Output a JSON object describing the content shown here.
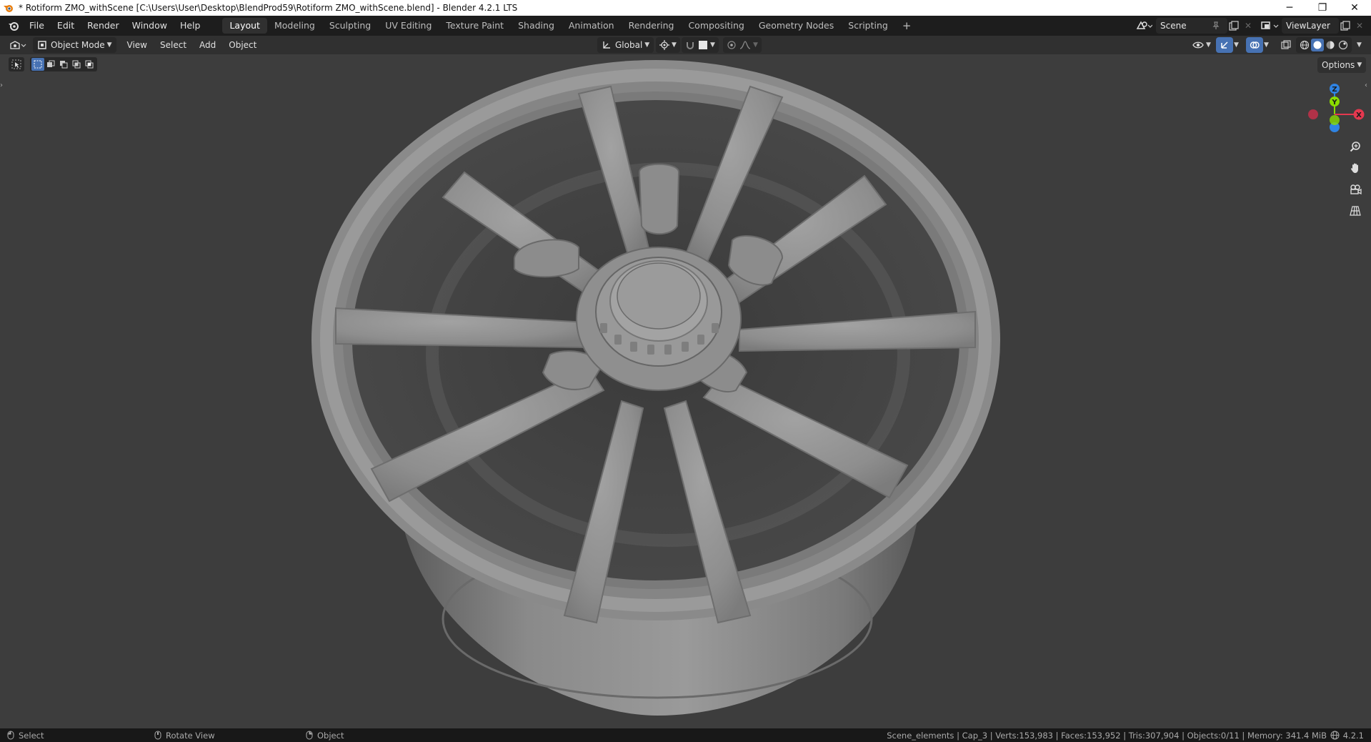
{
  "titlebar": {
    "title": "* Rotiform ZMO_withScene [C:\\Users\\User\\Desktop\\BlendProd59\\Rotiform ZMO_withScene.blend] - Blender 4.2.1 LTS",
    "minimize": "─",
    "maximize": "❐",
    "close": "✕"
  },
  "menu": {
    "items": [
      "File",
      "Edit",
      "Render",
      "Window",
      "Help"
    ]
  },
  "workspaces": {
    "tabs": [
      "Layout",
      "Modeling",
      "Sculpting",
      "UV Editing",
      "Texture Paint",
      "Shading",
      "Animation",
      "Rendering",
      "Compositing",
      "Geometry Nodes",
      "Scripting"
    ],
    "active": "Layout",
    "add": "+"
  },
  "scene": {
    "name": "Scene"
  },
  "view_layer": {
    "name": "ViewLayer"
  },
  "header": {
    "mode": "Object Mode",
    "menus": [
      "View",
      "Select",
      "Add",
      "Object"
    ],
    "transform_orientation": "Global"
  },
  "viewport": {
    "options_label": "Options",
    "gizmo": {
      "x": "X",
      "y": "Y",
      "z": "Z"
    }
  },
  "statusbar": {
    "left": [
      {
        "icon": "mouse-left-icon",
        "label": "Select"
      },
      {
        "icon": "mouse-middle-icon",
        "label": "Rotate View"
      },
      {
        "icon": "mouse-right-icon",
        "label": "Object"
      }
    ],
    "stats": "Scene_elements | Cap_3 | Verts:153,983 | Faces:153,952 | Tris:307,904 | Objects:0/11 | Memory: 341.4 MiB",
    "version": "4.2.1"
  },
  "colors": {
    "topbar": "#1d1d1d",
    "header": "#303030",
    "viewport": "#3d3d3d",
    "active_blue": "#4772b3",
    "axis_x": "#e5384f",
    "axis_y": "#8bdc00",
    "axis_z": "#2f83e3"
  }
}
